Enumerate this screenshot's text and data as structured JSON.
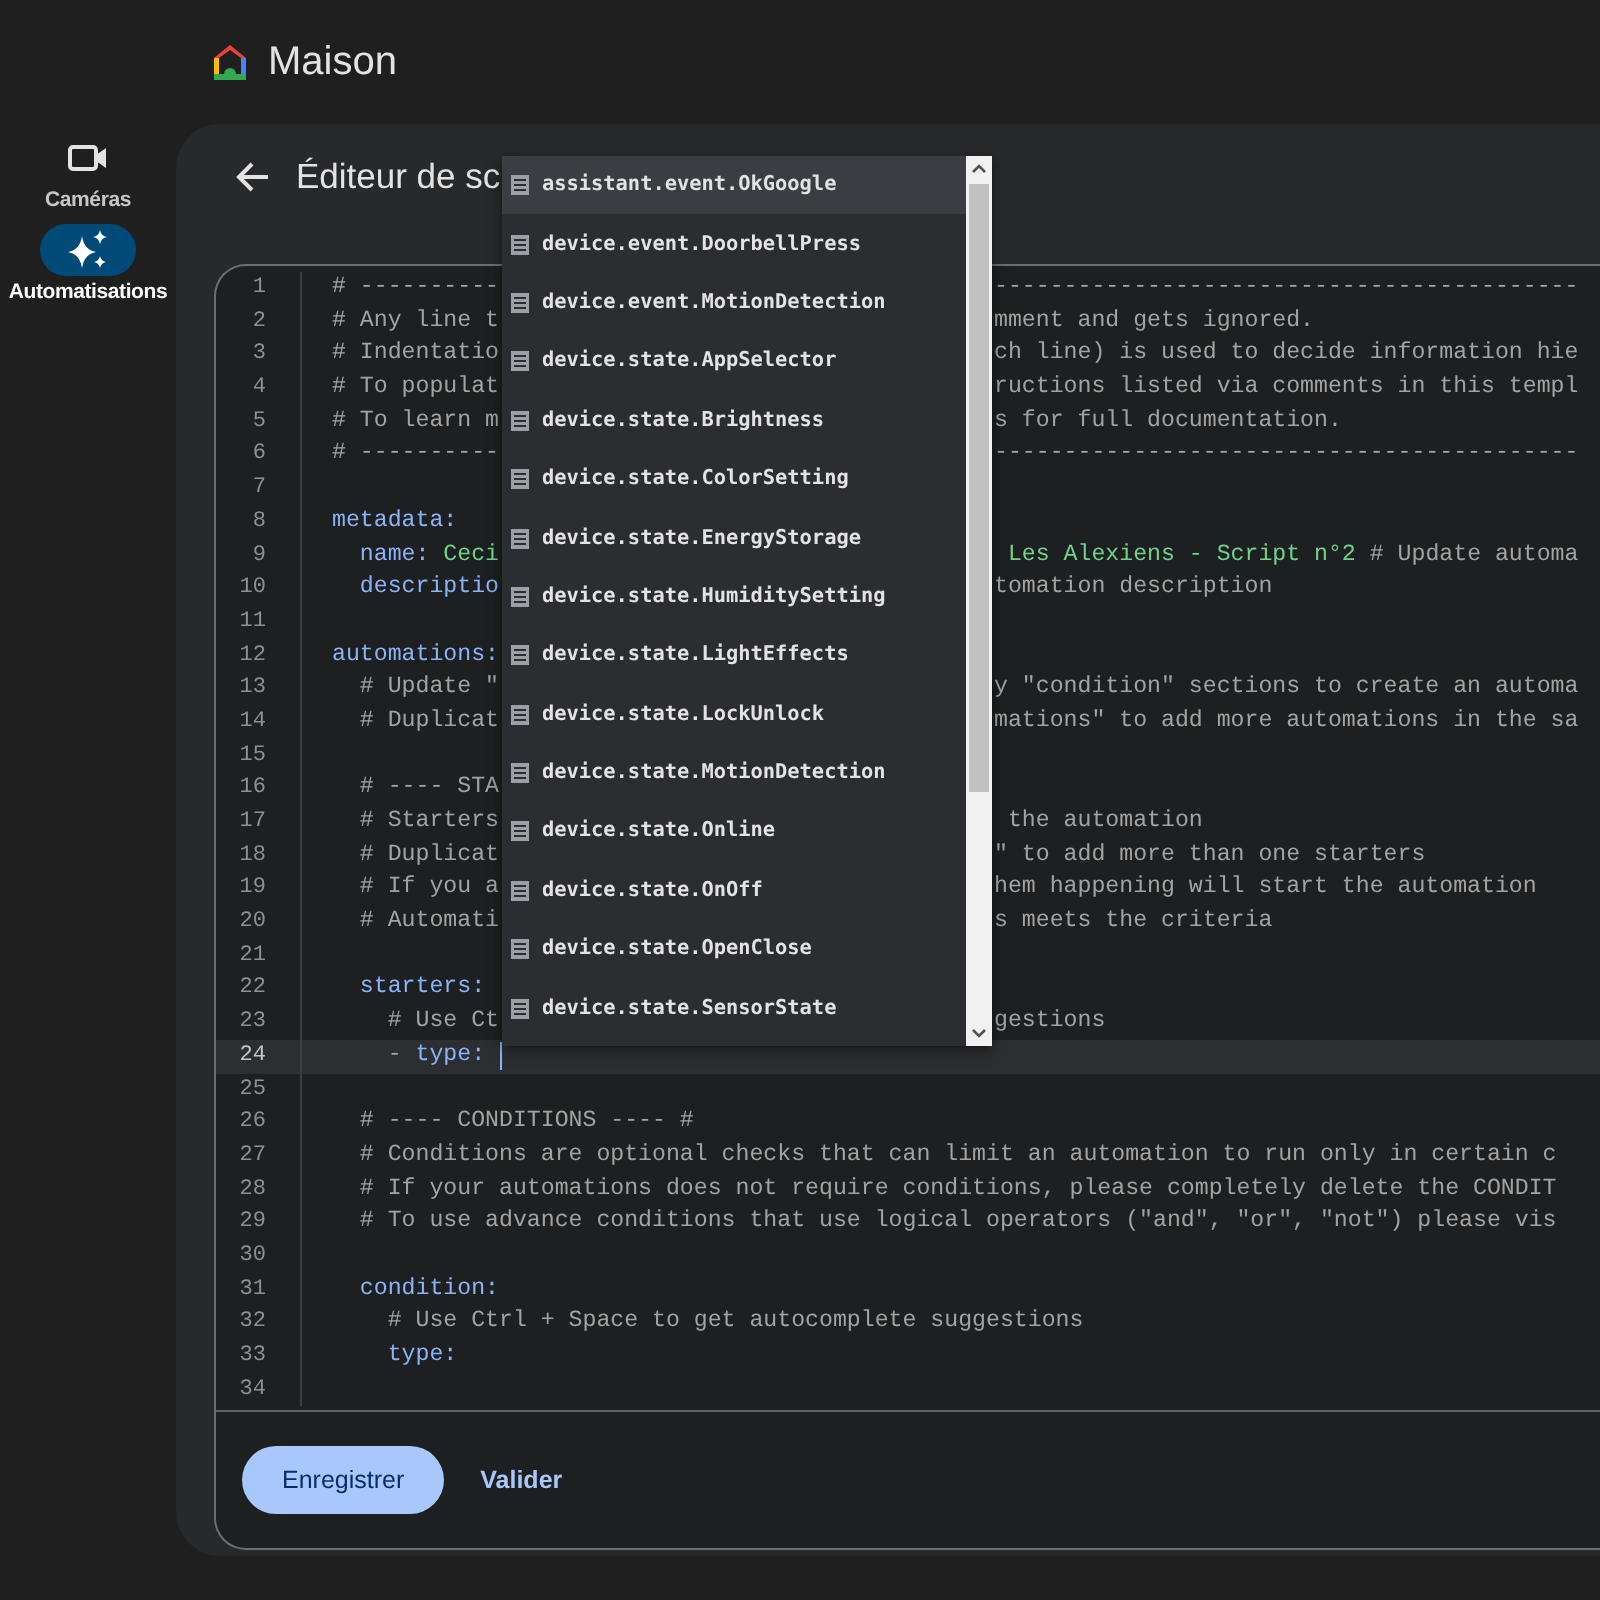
{
  "app": {
    "title": "Maison"
  },
  "sidebar": {
    "items": [
      {
        "label": "Caméras",
        "kind": "camera",
        "selected": false
      },
      {
        "label": "Automatisations",
        "kind": "sparkles",
        "selected": true
      }
    ]
  },
  "page": {
    "title": "Éditeur de sc"
  },
  "editor": {
    "lines": [
      {
        "number": "1",
        "current": false,
        "left": [
          {
            "kind": "comment",
            "text": "# ----------"
          }
        ],
        "right": [
          {
            "kind": "comment",
            "text": "------------------------------------------"
          }
        ]
      },
      {
        "number": "2",
        "current": false,
        "left": [
          {
            "kind": "comment",
            "text": "# Any line t"
          }
        ],
        "right": [
          {
            "kind": "comment",
            "text": "mment and gets ignored."
          }
        ]
      },
      {
        "number": "3",
        "current": false,
        "left": [
          {
            "kind": "comment",
            "text": "# Indentatio"
          }
        ],
        "right": [
          {
            "kind": "comment",
            "text": "ch line) is used to decide information hie"
          }
        ]
      },
      {
        "number": "4",
        "current": false,
        "left": [
          {
            "kind": "comment",
            "text": "# To populat"
          }
        ],
        "right": [
          {
            "kind": "comment",
            "text": "ructions listed via comments in this templ"
          }
        ]
      },
      {
        "number": "5",
        "current": false,
        "left": [
          {
            "kind": "comment",
            "text": "# To learn m"
          }
        ],
        "right": [
          {
            "kind": "comment",
            "text": "s for full documentation."
          }
        ]
      },
      {
        "number": "6",
        "current": false,
        "left": [
          {
            "kind": "comment",
            "text": "# ----------"
          }
        ],
        "right": [
          {
            "kind": "comment",
            "text": "------------------------------------------"
          }
        ]
      },
      {
        "number": "7",
        "current": false
      },
      {
        "number": "8",
        "current": false,
        "left": [
          {
            "kind": "key",
            "text": "metadata:"
          }
        ]
      },
      {
        "number": "9",
        "current": false,
        "left": [
          {
            "kind": "key",
            "text": "  name:"
          },
          {
            "kind": "string",
            "text": " Ceci"
          }
        ],
        "right": [
          {
            "kind": "string",
            "text": " Les Alexiens - Script n°2"
          },
          {
            "kind": "comment",
            "text": " # Update automa"
          }
        ]
      },
      {
        "number": "10",
        "current": false,
        "left": [
          {
            "kind": "key",
            "text": "  descriptio"
          }
        ],
        "right": [
          {
            "kind": "comment",
            "text": "tomation description"
          }
        ]
      },
      {
        "number": "11",
        "current": false
      },
      {
        "number": "12",
        "current": false,
        "left": [
          {
            "kind": "key",
            "text": "automations:"
          }
        ]
      },
      {
        "number": "13",
        "current": false,
        "left": [
          {
            "kind": "comment",
            "text": "  # Update \""
          }
        ],
        "right": [
          {
            "kind": "comment",
            "text": "y \"condition\" sections to create an automa"
          }
        ]
      },
      {
        "number": "14",
        "current": false,
        "left": [
          {
            "kind": "comment",
            "text": "  # Duplicat"
          }
        ],
        "right": [
          {
            "kind": "comment",
            "text": "mations\" to add more automations in the sa"
          }
        ]
      },
      {
        "number": "15",
        "current": false
      },
      {
        "number": "16",
        "current": false,
        "left": [
          {
            "kind": "comment",
            "text": "  # ---- STA"
          }
        ]
      },
      {
        "number": "17",
        "current": false,
        "left": [
          {
            "kind": "comment",
            "text": "  # Starters"
          }
        ],
        "right": [
          {
            "kind": "comment",
            "text": " the automation"
          }
        ]
      },
      {
        "number": "18",
        "current": false,
        "left": [
          {
            "kind": "comment",
            "text": "  # Duplicat"
          }
        ],
        "right": [
          {
            "kind": "comment",
            "text": "\" to add more than one starters"
          }
        ]
      },
      {
        "number": "19",
        "current": false,
        "left": [
          {
            "kind": "comment",
            "text": "  # If you a"
          }
        ],
        "right": [
          {
            "kind": "comment",
            "text": "hem happening will start the automation"
          }
        ]
      },
      {
        "number": "20",
        "current": false,
        "left": [
          {
            "kind": "comment",
            "text": "  # Automati"
          }
        ],
        "right": [
          {
            "kind": "comment",
            "text": "s meets the criteria"
          }
        ]
      },
      {
        "number": "21",
        "current": false
      },
      {
        "number": "22",
        "current": false,
        "left": [
          {
            "kind": "key",
            "text": "  starters:"
          }
        ]
      },
      {
        "number": "23",
        "current": false,
        "left": [
          {
            "kind": "comment",
            "text": "    # Use Ct"
          }
        ],
        "right": [
          {
            "kind": "comment",
            "text": "gestions"
          }
        ]
      },
      {
        "number": "24",
        "current": true,
        "left": [
          {
            "kind": "plain",
            "text": "    - "
          },
          {
            "kind": "key",
            "text": "type:"
          }
        ]
      },
      {
        "number": "25",
        "current": false
      },
      {
        "number": "26",
        "current": false,
        "left": [
          {
            "kind": "comment",
            "text": "  # ---- CONDITIONS ---- #"
          }
        ]
      },
      {
        "number": "27",
        "current": false,
        "left": [
          {
            "kind": "comment",
            "text": "  # Conditions are optional checks that can limit an automation to run only in certain c"
          }
        ]
      },
      {
        "number": "28",
        "current": false,
        "left": [
          {
            "kind": "comment",
            "text": "  # If your automations does not require conditions, please completely delete the CONDIT"
          }
        ]
      },
      {
        "number": "29",
        "current": false,
        "left": [
          {
            "kind": "comment",
            "text": "  # To use advance conditions that use logical operators (\"and\", \"or\", \"not\") please vis"
          }
        ]
      },
      {
        "number": "30",
        "current": false
      },
      {
        "number": "31",
        "current": false,
        "left": [
          {
            "kind": "key",
            "text": "  condition:"
          }
        ]
      },
      {
        "number": "32",
        "current": false,
        "left": [
          {
            "kind": "comment",
            "text": "    # Use Ctrl + Space to get autocomplete suggestions"
          }
        ]
      },
      {
        "number": "33",
        "current": false,
        "left": [
          {
            "kind": "key",
            "text": "    type:"
          }
        ]
      },
      {
        "number": "34",
        "current": false
      }
    ]
  },
  "autocomplete": {
    "items": [
      {
        "label": "assistant.event.OkGoogle",
        "selected": true
      },
      {
        "label": "device.event.DoorbellPress",
        "selected": false
      },
      {
        "label": "device.event.MotionDetection",
        "selected": false
      },
      {
        "label": "device.state.AppSelector",
        "selected": false
      },
      {
        "label": "device.state.Brightness",
        "selected": false
      },
      {
        "label": "device.state.ColorSetting",
        "selected": false
      },
      {
        "label": "device.state.EnergyStorage",
        "selected": false
      },
      {
        "label": "device.state.HumiditySetting",
        "selected": false
      },
      {
        "label": "device.state.LightEffects",
        "selected": false
      },
      {
        "label": "device.state.LockUnlock",
        "selected": false
      },
      {
        "label": "device.state.MotionDetection",
        "selected": false
      },
      {
        "label": "device.state.Online",
        "selected": false
      },
      {
        "label": "device.state.OnOff",
        "selected": false
      },
      {
        "label": "device.state.OpenClose",
        "selected": false
      },
      {
        "label": "device.state.SensorState",
        "selected": false
      }
    ]
  },
  "footer": {
    "buttons": [
      {
        "label": "Enregistrer",
        "kind": "filled"
      },
      {
        "label": "Valider",
        "kind": "text"
      }
    ]
  }
}
